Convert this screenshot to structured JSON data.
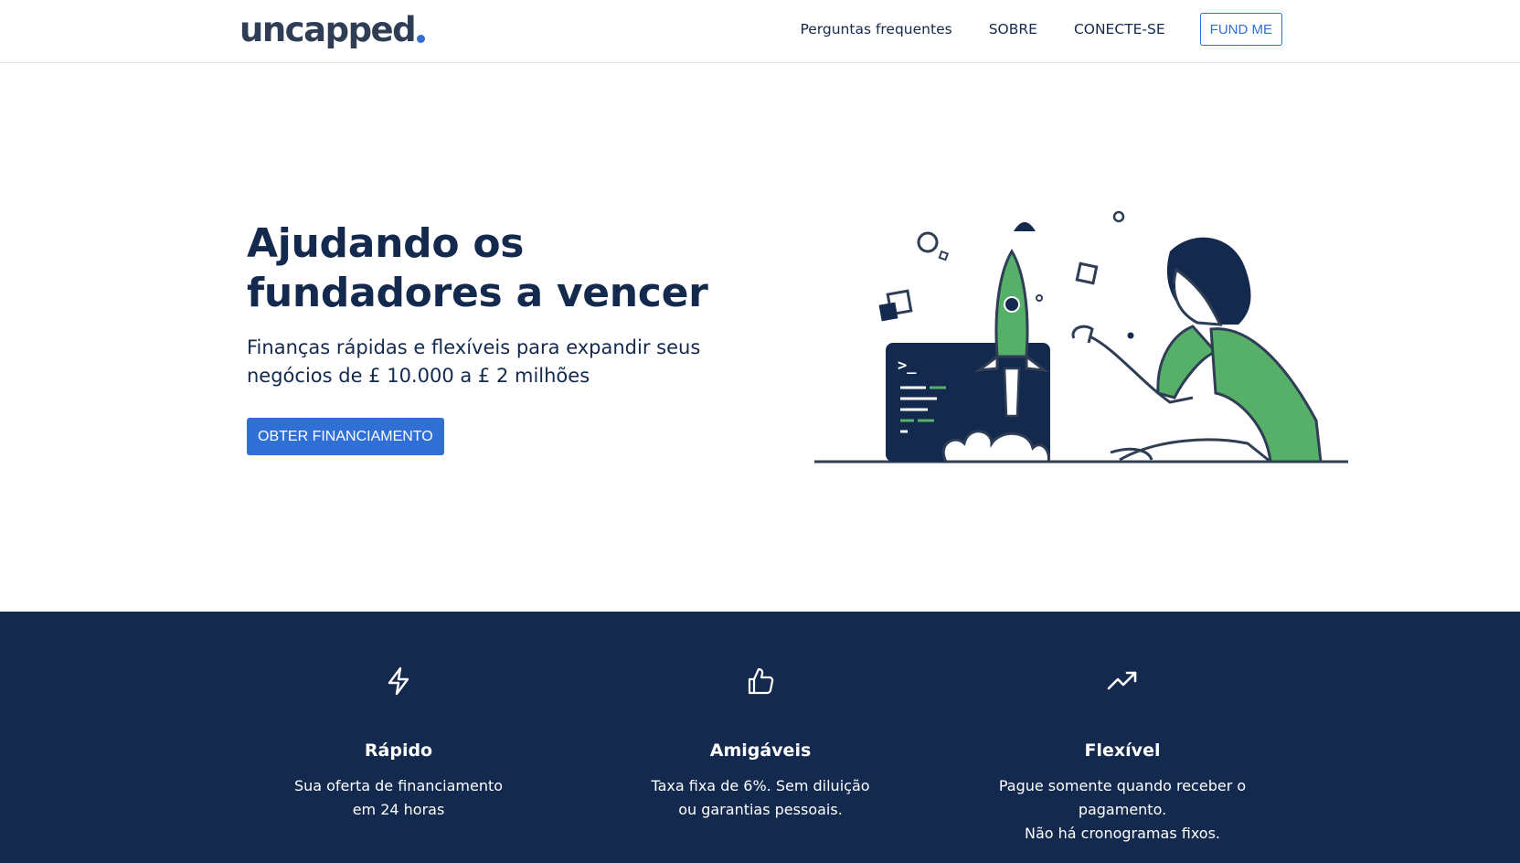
{
  "nav": {
    "logo": "uncapped",
    "links": [
      "Perguntas frequentes",
      "SOBRE",
      "CONECTE-SE"
    ],
    "fund_button": "FUND ME"
  },
  "hero": {
    "title_line1": "Ajudando os",
    "title_line2": "fundadores a vencer",
    "subtitle_line1": "Finanças rápidas e flexíveis para expandir seus",
    "subtitle_line2": "negócios de £ 10.000 a £ 2 milhões",
    "cta_label": "OBTER FINANCIAMENTO",
    "terminal_prompt": ">_"
  },
  "features": [
    {
      "icon": "lightning-icon",
      "title": "Rápido",
      "lines": [
        "Sua oferta de financiamento",
        "em 24 horas"
      ]
    },
    {
      "icon": "thumbs-up-icon",
      "title": "Amigáveis",
      "lines": [
        "Taxa fixa de 6%. Sem diluição",
        "ou garantias pessoais."
      ]
    },
    {
      "icon": "trending-up-icon",
      "title": "Flexível",
      "lines": [
        "Pague somente quando receber o",
        "pagamento.",
        "Não há cronogramas fixos."
      ]
    }
  ],
  "colors": {
    "navy": "#14294e",
    "brand_blue": "#2f6fd6",
    "green": "#56b06a"
  }
}
